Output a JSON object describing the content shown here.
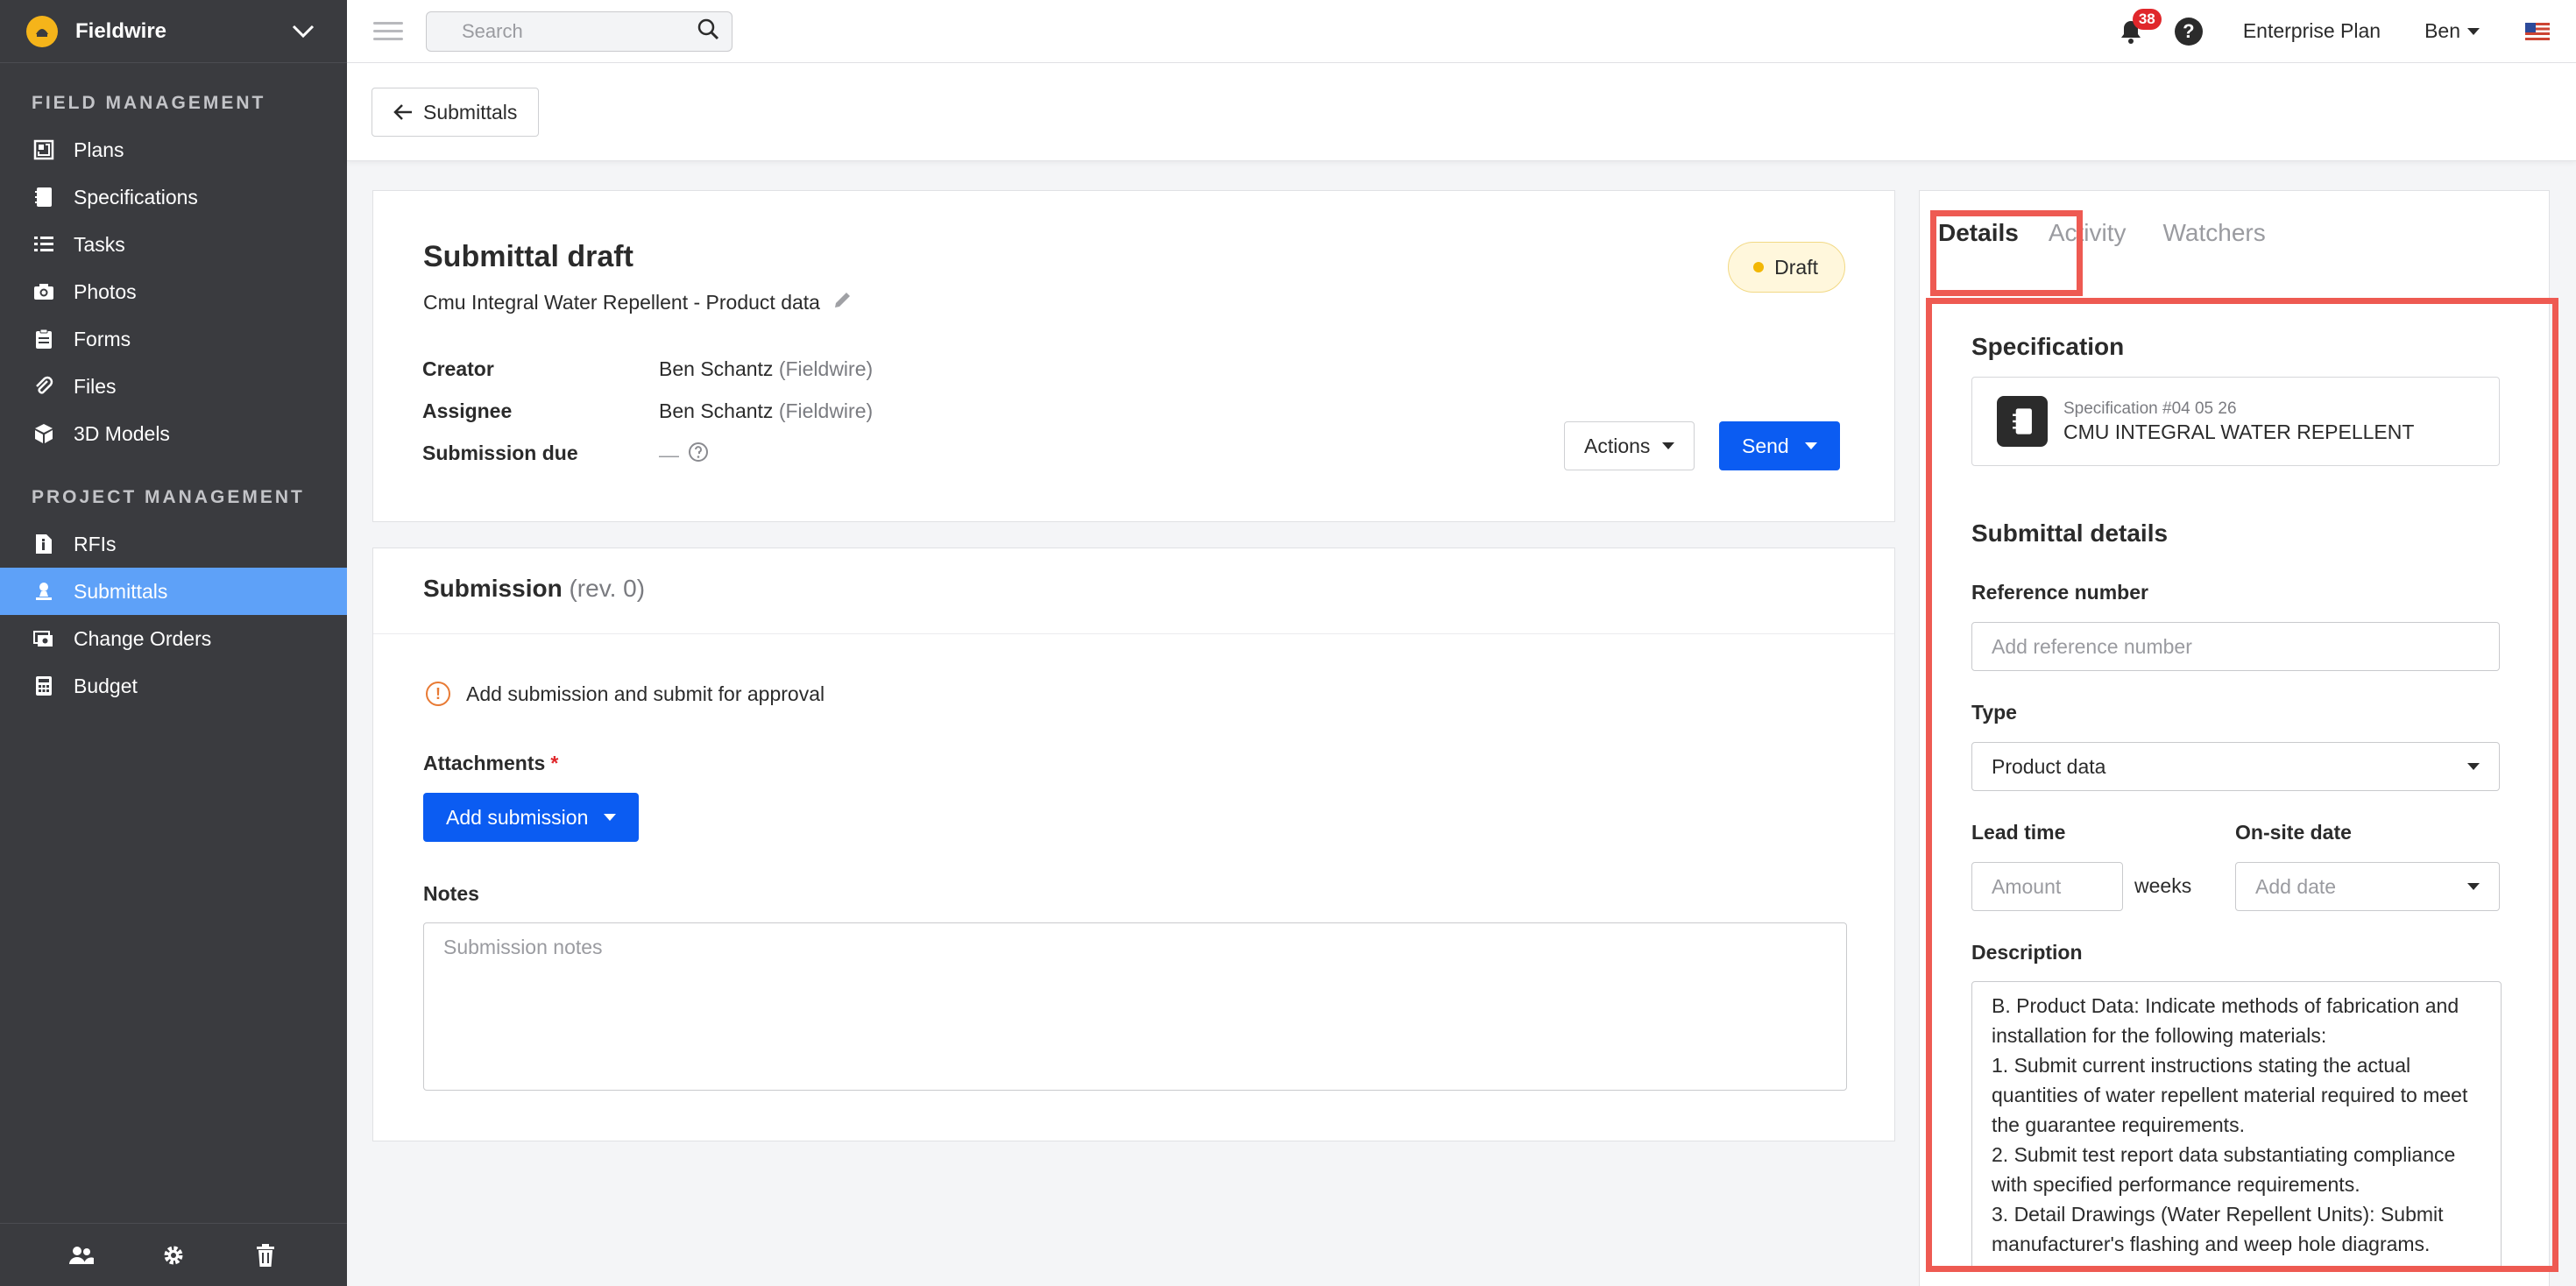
{
  "app": {
    "brand_name": "Fieldwire"
  },
  "sidebar": {
    "field_management_label": "FIELD MANAGEMENT",
    "project_management_label": "PROJECT MANAGEMENT",
    "field_items": [
      {
        "label": "Plans",
        "icon": "plans-icon"
      },
      {
        "label": "Specifications",
        "icon": "specifications-icon"
      },
      {
        "label": "Tasks",
        "icon": "tasks-icon"
      },
      {
        "label": "Photos",
        "icon": "camera-icon"
      },
      {
        "label": "Forms",
        "icon": "forms-icon"
      },
      {
        "label": "Files",
        "icon": "paperclip-icon"
      },
      {
        "label": "3D Models",
        "icon": "cube-icon"
      }
    ],
    "project_items": [
      {
        "label": "RFIs",
        "icon": "rfi-icon"
      },
      {
        "label": "Submittals",
        "icon": "submittal-icon",
        "active": true
      },
      {
        "label": "Change Orders",
        "icon": "change-orders-icon"
      },
      {
        "label": "Budget",
        "icon": "calculator-icon"
      }
    ],
    "active_color": "#5ea1f8",
    "background": "#3a3b3f"
  },
  "topbar": {
    "search_placeholder": "Search",
    "notification_count": "38",
    "help_label": "?",
    "plan_label": "Enterprise Plan",
    "user_name": "Ben"
  },
  "subheader": {
    "back_label": "Submittals"
  },
  "submittal": {
    "title": "Submittal draft",
    "subtitle": "Cmu Integral Water Repellent - Product data",
    "status": "Draft",
    "creator_label": "Creator",
    "creator_name": "Ben Schantz",
    "creator_org": "(Fieldwire)",
    "assignee_label": "Assignee",
    "assignee_name": "Ben Schantz",
    "assignee_org": "(Fieldwire)",
    "due_label": "Submission due",
    "due_value": "—",
    "actions_label": "Actions",
    "send_label": "Send"
  },
  "submission": {
    "title": "Submission",
    "revision": "(rev. 0)",
    "notice": "Add submission and submit for approval",
    "attachments_label": "Attachments",
    "required_mark": "*",
    "add_button": "Add submission",
    "notes_label": "Notes",
    "notes_placeholder": "Submission notes"
  },
  "panel": {
    "tabs": [
      {
        "label": "Details",
        "active": true
      },
      {
        "label": "Activity"
      },
      {
        "label": "Watchers"
      }
    ],
    "spec_heading": "Specification",
    "spec_number": "Specification #04 05 26",
    "spec_name": "CMU INTEGRAL WATER REPELLENT",
    "details_heading": "Submittal details",
    "reference_label": "Reference number",
    "reference_placeholder": "Add reference number",
    "type_label": "Type",
    "type_value": "Product data",
    "lead_time_label": "Lead time",
    "lead_time_placeholder": "Amount",
    "lead_time_unit": "weeks",
    "onsite_label": "On-site date",
    "onsite_placeholder": "Add date",
    "description_label": "Description",
    "description_text": "B. Product Data:  Indicate methods of fabrication and installation for the following materials:\n 1. Submit current instructions stating the actual quantities of water repellent material required to meet the guarantee requirements.\n 2. Submit test report data substantiating compliance with specified performance requirements.\n 3. Detail Drawings (Water Repellent Units):  Submit manufacturer's flashing and weep hole diagrams."
  },
  "colors": {
    "primary": "#0b5cf2",
    "highlight": "#ee5a52",
    "draft_badge": "#fff7dc",
    "notification_badge": "#e0272b"
  }
}
